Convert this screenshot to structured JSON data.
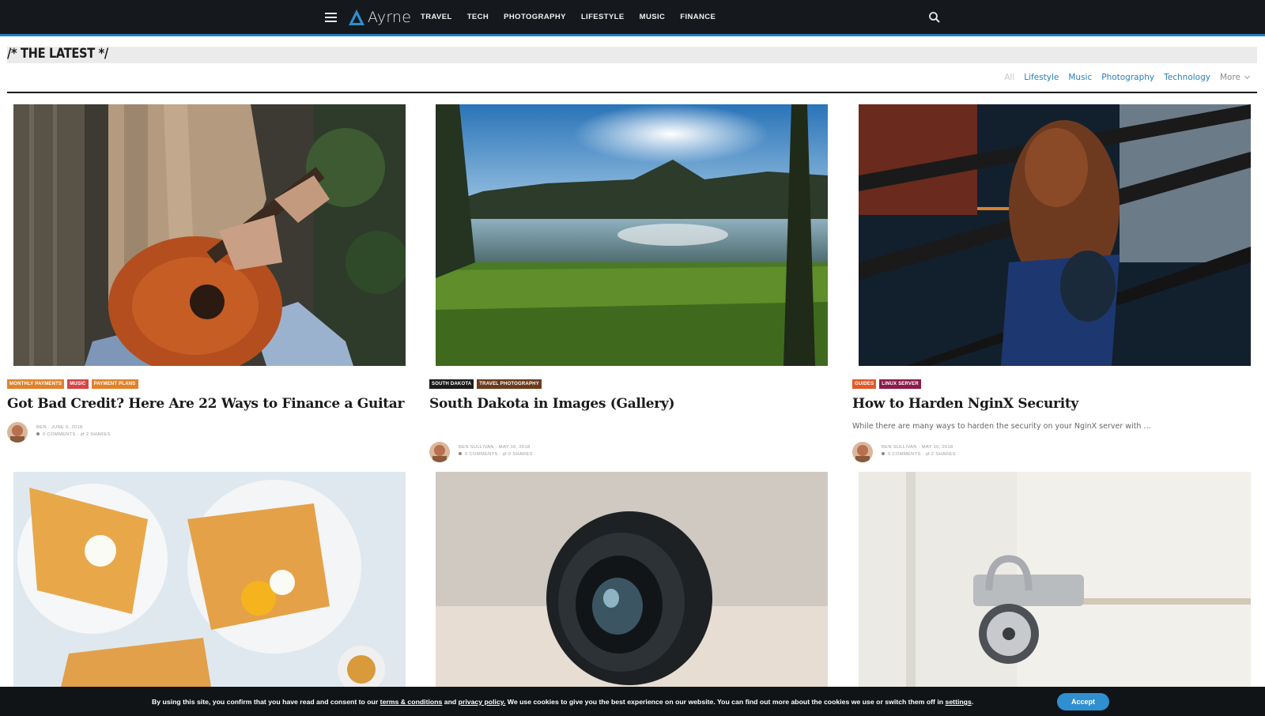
{
  "nav": {
    "logo_text": "Ayrne",
    "items": [
      "TRAVEL",
      "TECH",
      "PHOTOGRAPHY",
      "LIFESTYLE",
      "MUSIC",
      "FINANCE"
    ]
  },
  "section": {
    "title": "/* THE LATEST */",
    "filters": {
      "all": "All",
      "items": [
        "Lifestyle",
        "Music",
        "Photography",
        "Technology"
      ],
      "more": "More"
    }
  },
  "posts": [
    {
      "categories": [
        {
          "label": "MONTHLY PAYMENTS",
          "color": "#e0822c"
        },
        {
          "label": "MUSIC",
          "color": "#d64545"
        },
        {
          "label": "PAYMENT PLANS",
          "color": "#e0822c"
        }
      ],
      "title": "Got Bad Credit? Here Are 22 Ways to Finance a Guitar",
      "excerpt": "",
      "author_line": "BEN · JUNE 6, 2018",
      "stats_line": "0 COMMENTS · ⇄ 2 SHARES"
    },
    {
      "categories": [
        {
          "label": "SOUTH DAKOTA",
          "color": "#1c1c1c"
        },
        {
          "label": "TRAVEL PHOTOGRAPHY",
          "color": "#6b3b1c"
        }
      ],
      "title": "South Dakota in Images (Gallery)",
      "excerpt": "",
      "author_line": "BEN SULLIVAN · MAY 16, 2018",
      "stats_line": "0 COMMENTS · ⇄ 0 SHARES"
    },
    {
      "categories": [
        {
          "label": "GUIDES",
          "color": "#e05a2a"
        },
        {
          "label": "LINUX SERVER",
          "color": "#8a1c4a"
        }
      ],
      "title": "How to Harden NginX Security",
      "excerpt": "While there are many ways to harden the security on your NginX server with ...",
      "author_line": "BEN SULLIVAN · MAY 10, 2018",
      "stats_line": "0 COMMENTS · ⇄ 2 SHARES"
    }
  ],
  "cookie": {
    "text_1": "By using this site, you confirm that you have read and consent to our",
    "terms_link": "terms & conditions",
    "text_2": "and",
    "privacy_link": "privacy policy.",
    "text_3": "We use cookies to give you the best experience on our website. You can find out more about the cookies we use or switch them off in",
    "settings_link": "settings",
    "text_4": ".",
    "accept_label": "Accept"
  }
}
